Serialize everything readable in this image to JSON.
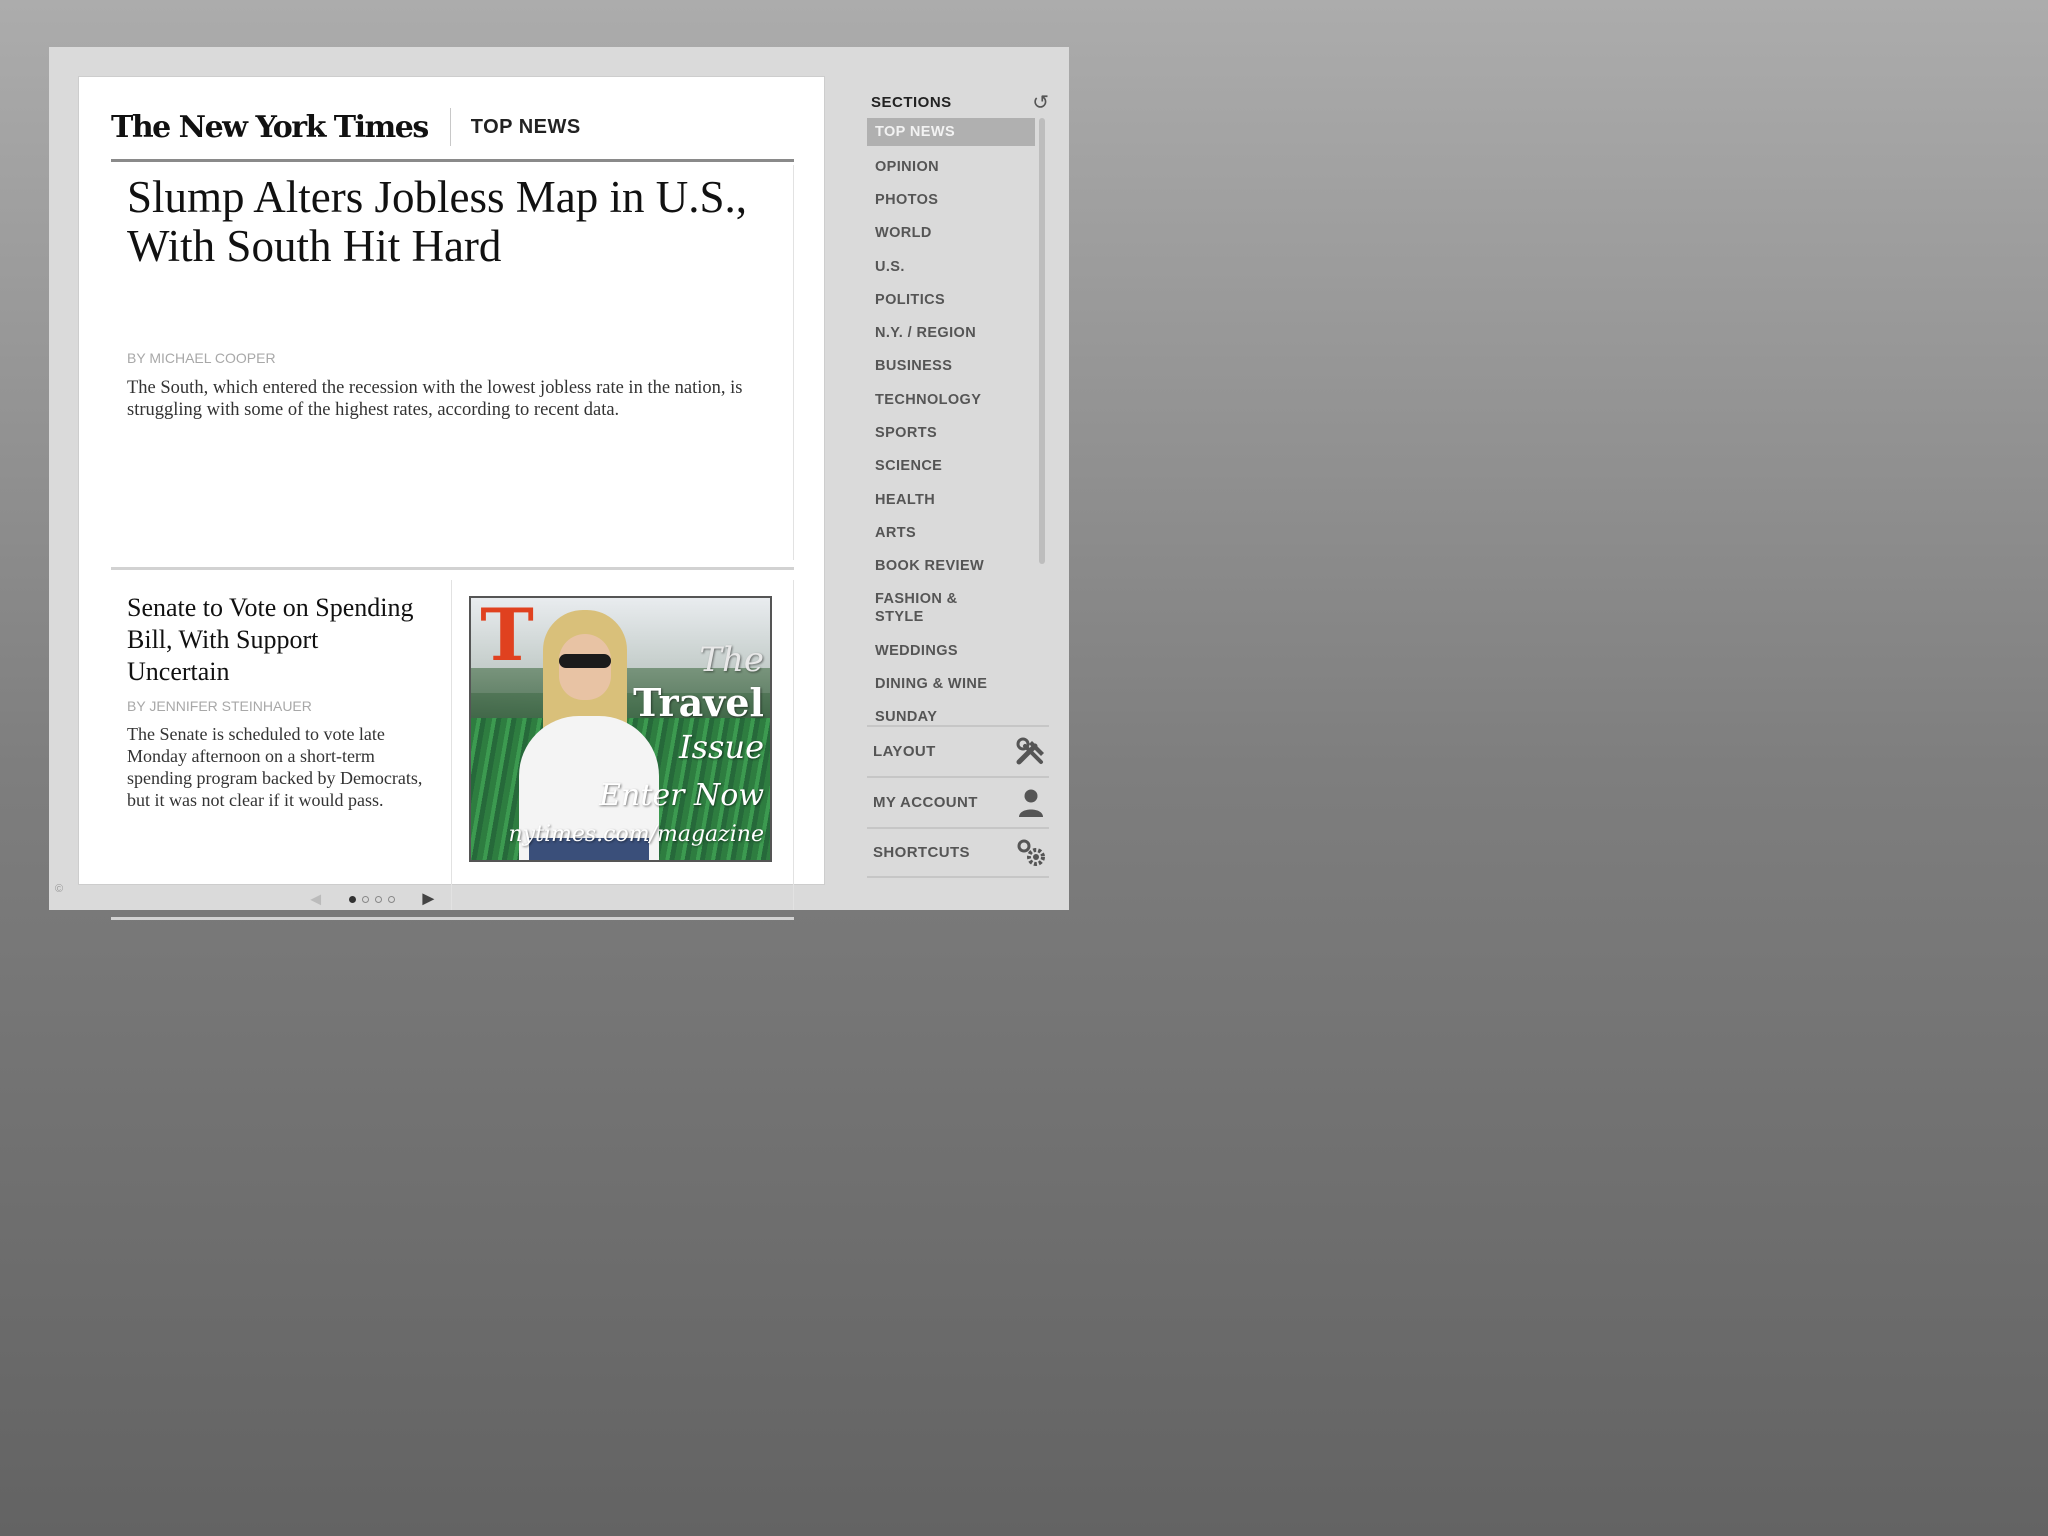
{
  "masthead": {
    "logo": "The New York Times",
    "section": "TOP NEWS"
  },
  "lead_story": {
    "headline": "Slump Alters Jobless Map in U.S., With South Hit Hard",
    "byline": "BY MICHAEL COOPER",
    "summary": "The South, which entered the recession with the lowest jobless rate in the nation, is struggling with some of the highest rates, according to recent data."
  },
  "second_story": {
    "headline": "Senate to Vote on Spending Bill, With Support Uncertain",
    "byline": "BY JENNIFER STEINHAUER",
    "summary": "The Senate is scheduled to vote late Monday afternoon on a short-term spending program backed by Democrats, but it was not clear if it would pass."
  },
  "ad": {
    "logo": "T",
    "line1": "The",
    "line2": "Travel",
    "line3": "Issue",
    "line4": "Enter Now",
    "line5": "nytimes.com/magazine"
  },
  "pager": {
    "prev": "◄",
    "next": "►",
    "page_count": 4,
    "current_page": 1
  },
  "sidebar": {
    "title": "SECTIONS",
    "sections": [
      {
        "label": "TOP NEWS",
        "active": true
      },
      {
        "label": "OPINION"
      },
      {
        "label": "PHOTOS"
      },
      {
        "label": "WORLD"
      },
      {
        "label": "U.S."
      },
      {
        "label": "POLITICS"
      },
      {
        "label": "N.Y. / REGION"
      },
      {
        "label": "BUSINESS"
      },
      {
        "label": "TECHNOLOGY"
      },
      {
        "label": "SPORTS"
      },
      {
        "label": "SCIENCE"
      },
      {
        "label": "HEALTH"
      },
      {
        "label": "ARTS"
      },
      {
        "label": "BOOK REVIEW"
      },
      {
        "label": "FASHION & STYLE"
      },
      {
        "label": "WEDDINGS"
      },
      {
        "label": "DINING & WINE"
      },
      {
        "label": "SUNDAY"
      }
    ],
    "actions": {
      "layout": "LAYOUT",
      "account": "MY ACCOUNT",
      "shortcuts": "SHORTCUTS"
    }
  },
  "icons": {
    "refresh": "refresh-icon",
    "layout": "tools-icon",
    "account": "person-icon",
    "shortcuts": "gears-icon"
  },
  "colors": {
    "ad_logo": "#e0411f",
    "active_section": "#b0b0b0"
  }
}
